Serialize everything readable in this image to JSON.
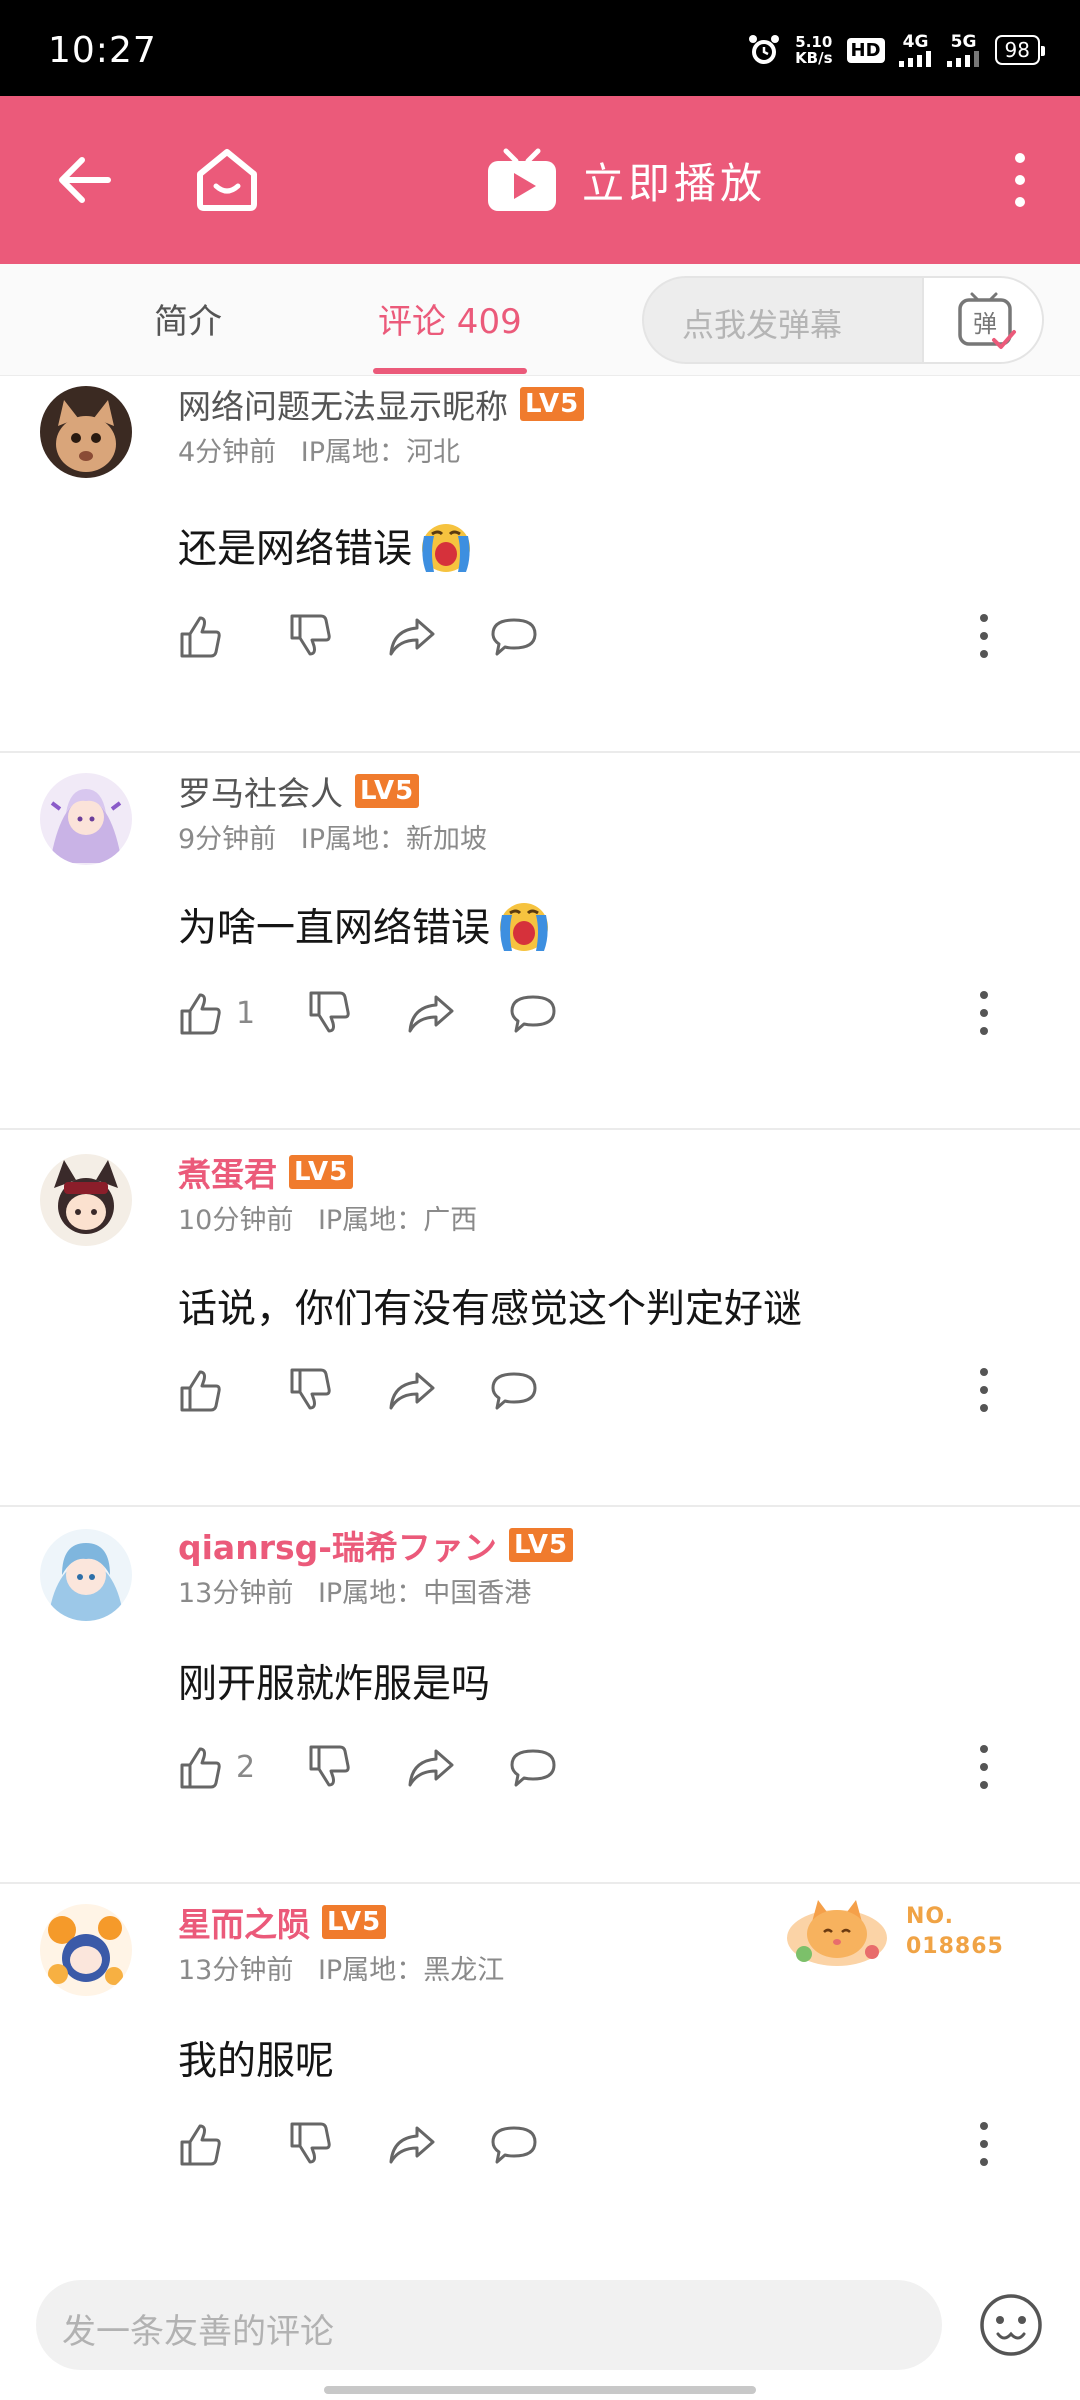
{
  "status_bar": {
    "time": "10:27",
    "net_speed_value": "5.10",
    "net_speed_unit": "KB/s",
    "hd_label": "HD",
    "sim1_label": "4G",
    "sim2_label": "5G",
    "battery": "98"
  },
  "header": {
    "play_label": "立即播放"
  },
  "tabs": {
    "intro_label": "简介",
    "comments_label": "评论 409",
    "danmaku_placeholder": "点我发弹幕",
    "danmaku_btn_label": "弹"
  },
  "comments": [
    {
      "username": "网络问题无法显示昵称",
      "level": "LV5",
      "time": "4分钟前",
      "ip": "IP属地：河北",
      "text": "还是网络错误",
      "likes": ""
    },
    {
      "username": "罗马社会人",
      "level": "LV5",
      "time": "9分钟前",
      "ip": "IP属地：新加坡",
      "text": "为啥一直网络错误",
      "likes": "1"
    },
    {
      "username": "煮蛋君",
      "level": "LV5",
      "time": "10分钟前",
      "ip": "IP属地：广西",
      "text": "话说，你们有没有感觉这个判定好谜",
      "likes": ""
    },
    {
      "username": "qianrsg-瑞希ファン",
      "level": "LV5",
      "time": "13分钟前",
      "ip": "IP属地：中国香港",
      "text": "刚开服就炸服是吗",
      "likes": "2"
    },
    {
      "username": "星而之陨",
      "level": "LV5",
      "time": "13分钟前",
      "ip": "IP属地：黑龙江",
      "text": "我的服呢",
      "likes": "",
      "medal_no": "NO.",
      "medal_id": "018865"
    }
  ],
  "bottom": {
    "comment_placeholder": "发一条友善的评论"
  },
  "colors": {
    "brand_pink": "#eb5a7a",
    "level_orange": "#f07b2d",
    "medal_gold": "#f0a345"
  },
  "icons": [
    "back-arrow-icon",
    "home-tv-icon",
    "play-tv-icon",
    "more-vertical-icon",
    "danmaku-icon",
    "like-icon",
    "dislike-icon",
    "share-icon",
    "reply-icon",
    "crying-emoji-icon",
    "emoji-face-icon",
    "alarm-icon"
  ]
}
